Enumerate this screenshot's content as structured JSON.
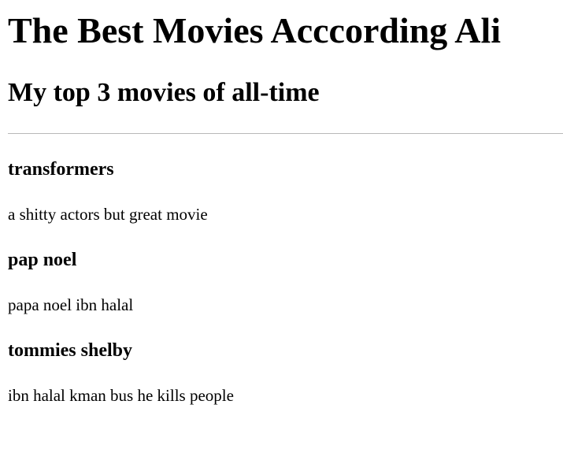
{
  "header": {
    "title": "The Best Movies Acccording Ali",
    "subtitle": "My top 3 movies of all-time"
  },
  "movies": [
    {
      "title": "transformers",
      "description": "a shitty actors but great movie"
    },
    {
      "title": "pap noel",
      "description": "papa noel ibn halal"
    },
    {
      "title": "tommies shelby",
      "description": "ibn halal kman bus he kills people"
    }
  ]
}
